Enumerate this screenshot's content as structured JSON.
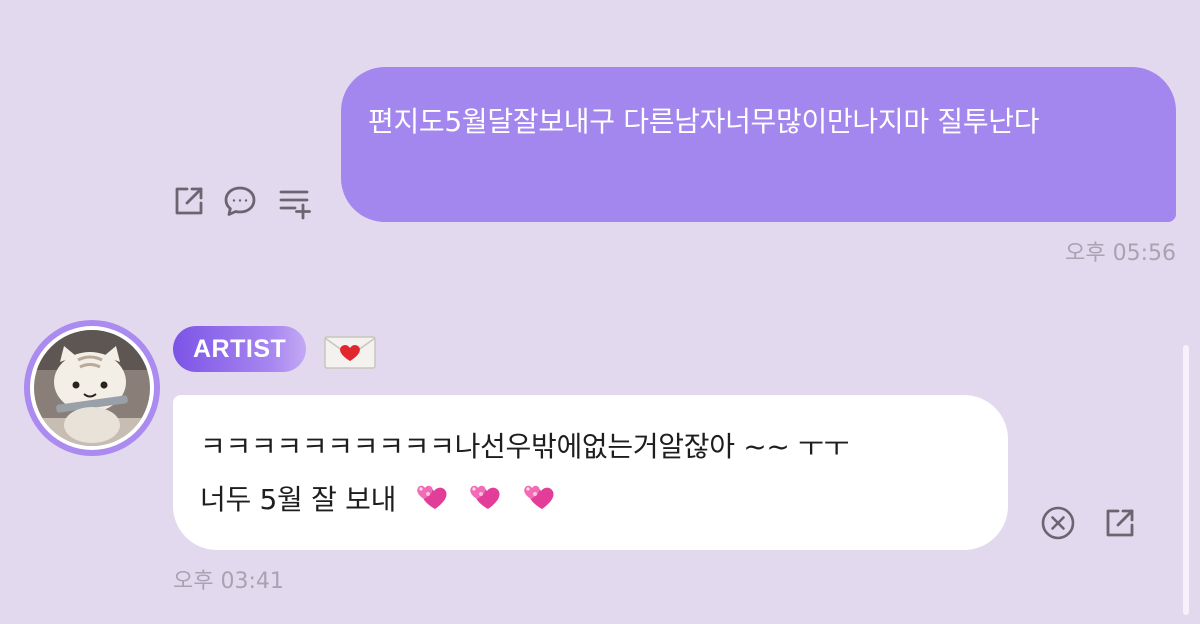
{
  "outgoing": {
    "text": "편지도5월달잘보내구 다른남자너무많이만나지마 질투난다",
    "timestamp": "오후 05:56",
    "actions": [
      "share-icon",
      "reply-icon",
      "add-list-icon"
    ]
  },
  "incoming": {
    "badge": "ARTIST",
    "badge_icon": "heart-letter-icon",
    "line1": "ㅋㅋㅋㅋㅋㅋㅋㅋㅋㅋ나선우밖에없는거알잖아 ~~ ㅜㅜ",
    "line2": "너두 5월 잘 보내",
    "emoji_count": 3,
    "emoji_name": "two-hearts-icon",
    "timestamp": "오후 03:41",
    "actions": [
      "close-circle-icon",
      "share-icon"
    ]
  },
  "colors": {
    "background": "#e3d9ef",
    "outgoing_bubble": "#a386ee",
    "incoming_bubble": "#ffffff",
    "badge": "#7b54e6",
    "timestamp": "#a9a3b0"
  }
}
